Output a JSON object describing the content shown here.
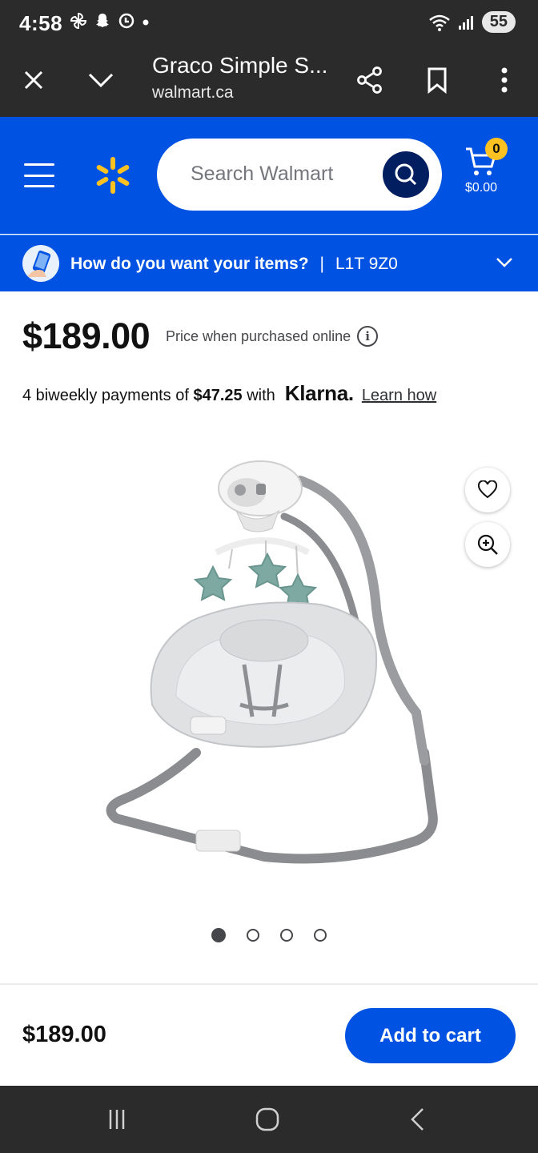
{
  "status_bar": {
    "time": "4:58",
    "battery": "55",
    "icons": [
      "pinwheel-icon",
      "snapchat-icon",
      "sync-icon",
      "dot-icon",
      "wifi-icon",
      "signal-icon",
      "battery-icon"
    ]
  },
  "browser": {
    "tab_title": "Graco Simple S...",
    "url": "walmart.ca",
    "icons": [
      "close-icon",
      "chevron-down-icon",
      "share-icon",
      "bookmark-icon",
      "more-vert-icon"
    ]
  },
  "header": {
    "search_placeholder": "Search Walmart",
    "cart_count": "0",
    "cart_total": "$0.00",
    "brand_color": "#0053e2",
    "spark_color": "#ffc220"
  },
  "delivery": {
    "question": "How do you want your items?",
    "separator": "|",
    "postal_code": "L1T 9Z0"
  },
  "product": {
    "price": "$189.00",
    "price_note": "Price when purchased online",
    "info_symbol": "i",
    "klarna_prefix": "4 biweekly payments of",
    "klarna_amount": "$47.25",
    "klarna_with": "with",
    "klarna_logo": "Klarna.",
    "learn_how": "Learn how",
    "image_count": 4,
    "active_image": 1
  },
  "bottom_bar": {
    "price": "$189.00",
    "add_to_cart": "Add to cart"
  },
  "android_nav": [
    "recents-icon",
    "home-icon",
    "back-icon"
  ]
}
